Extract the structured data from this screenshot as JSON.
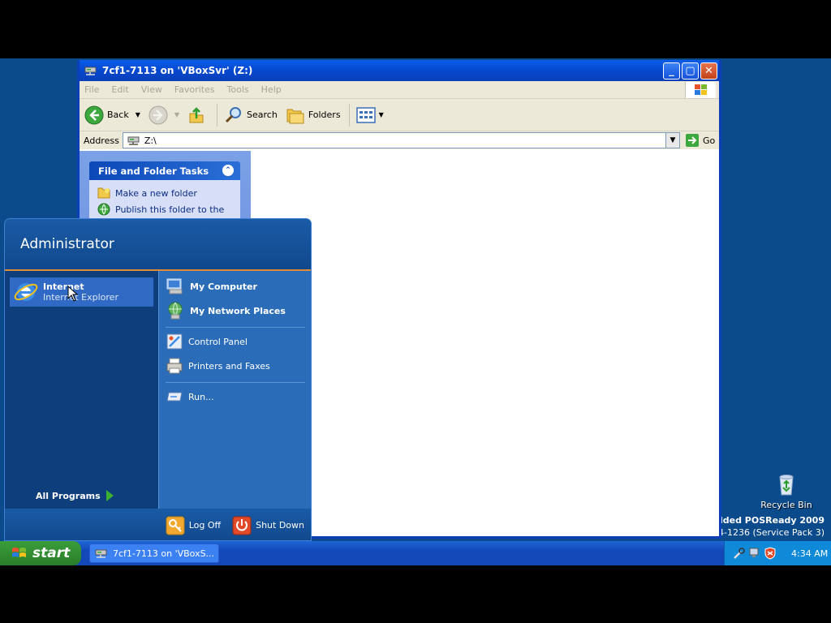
{
  "window": {
    "title": "7cf1-7113 on 'VBoxSvr' (Z:)",
    "menus": [
      "File",
      "Edit",
      "View",
      "Favorites",
      "Tools",
      "Help"
    ],
    "toolbar": {
      "back_label": "Back",
      "search_label": "Search",
      "folders_label": "Folders"
    },
    "address": {
      "label": "Address",
      "value": "Z:\\",
      "go_label": "Go"
    },
    "tasks": {
      "header": "File and Folder Tasks",
      "items": [
        "Make a new folder",
        "Publish this folder to the"
      ]
    }
  },
  "start_menu": {
    "user": "Administrator",
    "pinned": {
      "title": "Internet",
      "subtitle": "Internet Explorer"
    },
    "all_programs": "All Programs",
    "right_items": {
      "my_computer": "My Computer",
      "my_network": "My Network Places",
      "control_panel": "Control Panel",
      "printers": "Printers and Faxes",
      "run": "Run..."
    },
    "log_off": "Log Off",
    "shut_down": "Shut Down"
  },
  "desktop": {
    "recycle_bin": "Recycle Bin",
    "watermark_line1": "nbedded POSReady 2009",
    "watermark_line2": "314-1236 (Service Pack 3)"
  },
  "taskbar": {
    "start_label": "start",
    "task_button": "7cf1-7113 on 'VBoxS...",
    "clock": "4:34 AM"
  },
  "colors": {
    "desktop": "#0b4a8b",
    "titlebar": "#0548cf",
    "taskbar": "#1348b8",
    "start_green": "#2a7d2a",
    "selection": "#316ac5"
  }
}
